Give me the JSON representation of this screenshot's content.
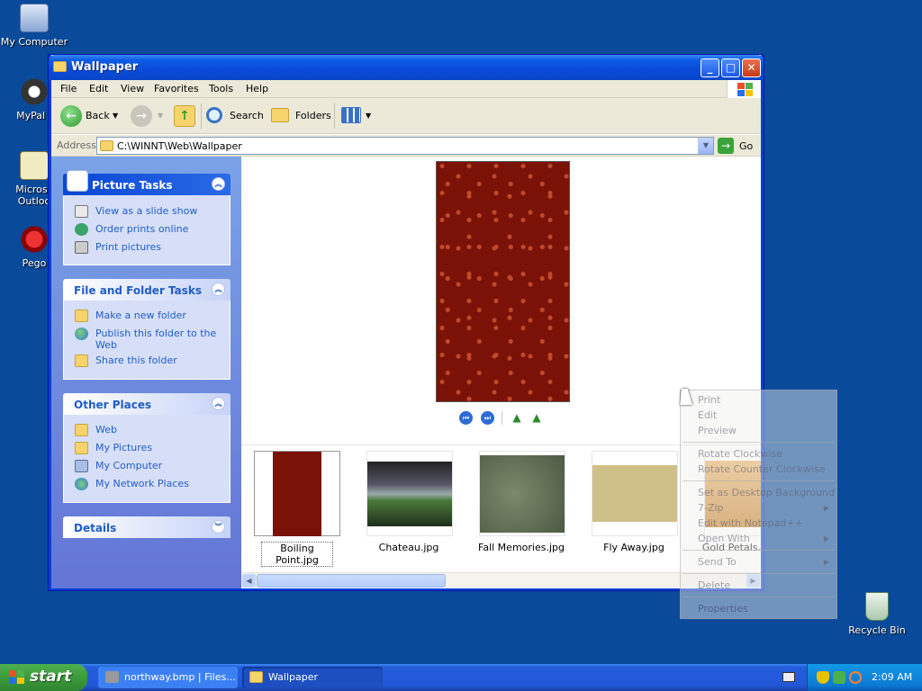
{
  "desktop": {
    "icons": [
      {
        "label": "My Computer"
      },
      {
        "label": "MyPal t"
      },
      {
        "label": "Microsc Outloo"
      },
      {
        "label": "Pego"
      },
      {
        "label": "Recycle Bin"
      }
    ]
  },
  "window": {
    "title": "Wallpaper",
    "menu": [
      "File",
      "Edit",
      "View",
      "Favorites",
      "Tools",
      "Help"
    ],
    "toolbar": {
      "back_label": "Back",
      "search_label": "Search",
      "folders_label": "Folders"
    },
    "address": {
      "label": "Address",
      "value": "C:\\WINNT\\Web\\Wallpaper",
      "go_label": "Go"
    }
  },
  "sidepanel": {
    "picture_tasks": {
      "title": "Picture Tasks",
      "items": [
        "View as a slide show",
        "Order prints online",
        "Print pictures"
      ]
    },
    "file_folder_tasks": {
      "title": "File and Folder Tasks",
      "items": [
        "Make a new folder",
        "Publish this folder to the Web",
        "Share this folder"
      ]
    },
    "other_places": {
      "title": "Other Places",
      "items": [
        "Web",
        "My Pictures",
        "My Computer",
        "My Network Places"
      ]
    },
    "details": {
      "title": "Details"
    }
  },
  "filmstrip": {
    "thumbnails": [
      {
        "name": "Boiling Point.jpg",
        "selected": true
      },
      {
        "name": "Chateau.jpg",
        "selected": false
      },
      {
        "name": "Fall Memories.jpg",
        "selected": false
      },
      {
        "name": "Fly Away.jpg",
        "selected": false
      },
      {
        "name": "Gold Petals.",
        "selected": false
      }
    ]
  },
  "context_menu": {
    "items": [
      "Print",
      "Edit",
      "Preview",
      "Rotate Clockwise",
      "Rotate Counter Clockwise",
      "Set as Desktop Background",
      "7-Zip",
      "Edit with Notepad++",
      "Open With",
      "Send To",
      "Delete",
      "Properties"
    ]
  },
  "taskbar": {
    "start_label": "start",
    "tasks": [
      {
        "label": "northway.bmp | Files..."
      },
      {
        "label": "Wallpaper"
      }
    ],
    "clock": "2:09 AM"
  },
  "colors": {
    "desktop": "#0a4a9a",
    "titlebar": "#0a4ad8",
    "start_green": "#3c9a3c",
    "task_link": "#215dc6"
  }
}
